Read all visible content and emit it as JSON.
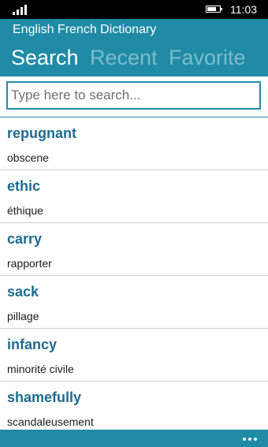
{
  "status": {
    "time": "11:03",
    "battery_level": 0.75,
    "signal_bars": 4
  },
  "app": {
    "title": "English French Dictionary"
  },
  "tabs": [
    {
      "label": "Search",
      "active": true
    },
    {
      "label": "Recent",
      "active": false
    },
    {
      "label": "Favorite",
      "active": false
    }
  ],
  "search": {
    "placeholder": "Type here to search...",
    "value": ""
  },
  "entries": [
    {
      "word": "repugnant",
      "translation": "obscene"
    },
    {
      "word": "ethic",
      "translation": "éthique"
    },
    {
      "word": "carry",
      "translation": "rapporter"
    },
    {
      "word": "sack",
      "translation": "pillage"
    },
    {
      "word": "infancy",
      "translation": "minorité civile"
    },
    {
      "word": "shamefully",
      "translation": "scandaleusement"
    }
  ],
  "colors": {
    "accent": "#1f8ba6",
    "word": "#1f6b8e",
    "divider": "#c9d1d7"
  },
  "icons": {
    "signal": "signal-strength-icon",
    "battery": "battery-icon",
    "more": "more-ellipsis-icon"
  }
}
